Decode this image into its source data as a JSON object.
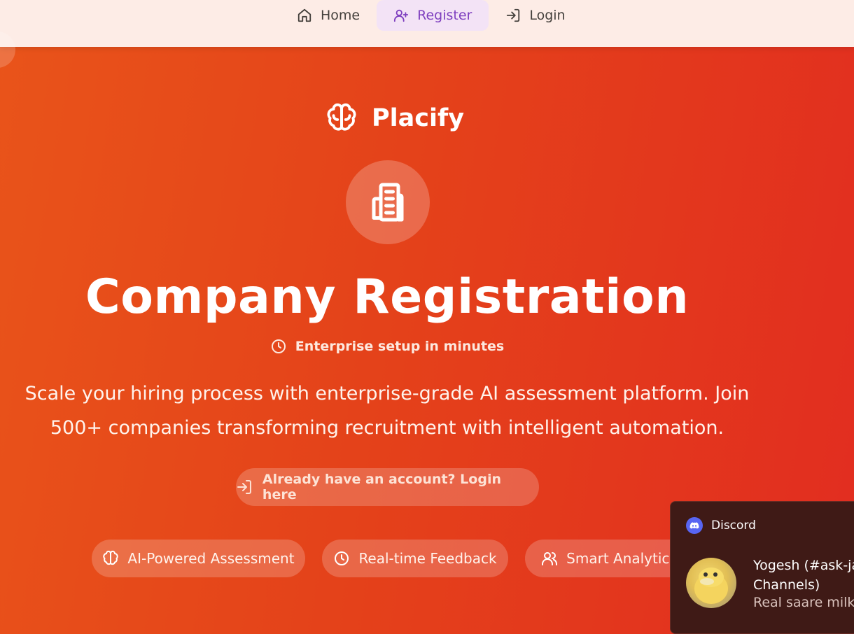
{
  "nav": {
    "items": [
      {
        "label": "Home",
        "icon": "home-icon",
        "active": false
      },
      {
        "label": "Register",
        "icon": "user-plus-icon",
        "active": true
      },
      {
        "label": "Login",
        "icon": "login-icon",
        "active": false
      }
    ]
  },
  "brand": {
    "name": "Placify",
    "icon": "brain-icon"
  },
  "hero": {
    "icon": "building-icon",
    "title": "Company Registration",
    "subtitle": "Enterprise setup in minutes",
    "description_line1": "Scale your hiring process with enterprise-grade AI assessment platform. Join",
    "description_line2": "500+ companies transforming recruitment with intelligent automation.",
    "login_link": "Already have an account? Login here"
  },
  "features": [
    {
      "label": "AI-Powered Assessment",
      "icon": "brain-icon"
    },
    {
      "label": "Real-time Feedback",
      "icon": "clock-icon"
    },
    {
      "label": "Smart Analytics",
      "icon": "users-icon"
    }
  ],
  "toast": {
    "app": "Discord",
    "title_line1": "Yogesh (#ask-ja",
    "title_line2": "Channels)",
    "body": "Real saare milko"
  },
  "colors": {
    "gradient_start": "#e9541a",
    "gradient_end": "#e22d20",
    "nav_bg": "#fdece6",
    "nav_active_bg": "#f3e3f6",
    "nav_active_text": "#7e3fbf",
    "discord": "#5865f2"
  }
}
